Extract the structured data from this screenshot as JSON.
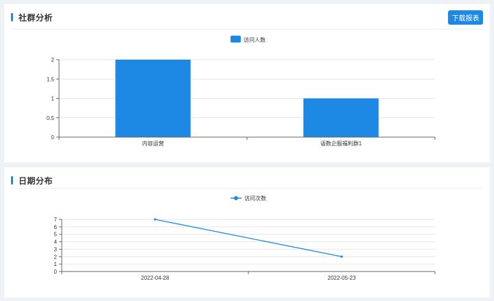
{
  "community_section": {
    "title": "社群分析",
    "download_label": "下载报表"
  },
  "date_section": {
    "title": "日期分布"
  },
  "chart_data": [
    {
      "type": "bar",
      "legend": "访问人数",
      "legend_position": "top-center",
      "categories": [
        "内容运营",
        "语数企服福利群1"
      ],
      "series": [
        {
          "name": "访问人数",
          "values": [
            2,
            1
          ]
        }
      ],
      "ylim": [
        0,
        2
      ],
      "yticks": [
        "0",
        "0.5",
        "1",
        "1.5",
        "2"
      ],
      "color": "#1e88e5",
      "grid": true
    },
    {
      "type": "line",
      "legend": "访问次数",
      "legend_position": "top-center",
      "categories": [
        "2022-04-28",
        "2022-05-23"
      ],
      "series": [
        {
          "name": "访问次数",
          "values": [
            7,
            2
          ]
        }
      ],
      "ylim": [
        0,
        7
      ],
      "yticks": [
        "0",
        "1",
        "2",
        "3",
        "4",
        "5",
        "6",
        "7"
      ],
      "color": "#1e88e5",
      "grid": true
    }
  ]
}
